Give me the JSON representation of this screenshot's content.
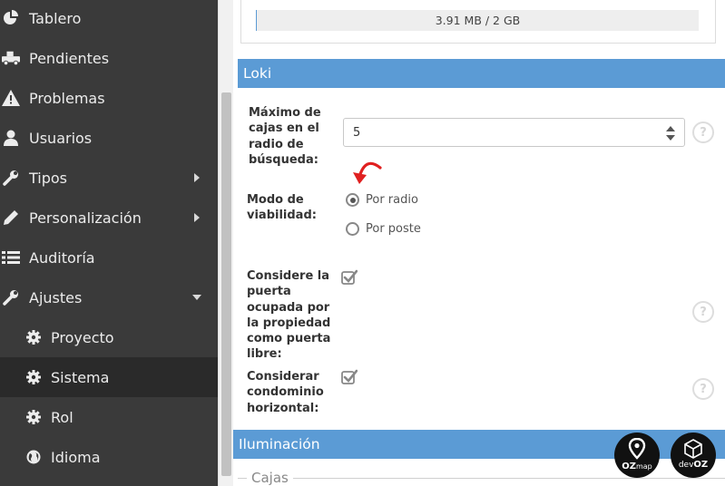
{
  "sidebar": {
    "items": [
      {
        "label": "Tablero",
        "icon": "pie-chart-icon"
      },
      {
        "label": "Pendientes",
        "icon": "truck-icon"
      },
      {
        "label": "Problemas",
        "icon": "warning-icon"
      },
      {
        "label": "Usuarios",
        "icon": "user-icon"
      },
      {
        "label": "Tipos",
        "icon": "wrench-icon"
      },
      {
        "label": "Personalización",
        "icon": "pencil-icon"
      },
      {
        "label": "Auditoría",
        "icon": "list-icon"
      },
      {
        "label": "Ajustes",
        "icon": "wrench-icon"
      },
      {
        "label": "Proyecto",
        "icon": "gear-icon"
      },
      {
        "label": "Sistema",
        "icon": "gear-icon"
      },
      {
        "label": "Rol",
        "icon": "gear-icon"
      },
      {
        "label": "Idioma",
        "icon": "globe-icon"
      }
    ],
    "active_item": "Sistema"
  },
  "storage": {
    "usage_text": "3.91 MB / 2 GB"
  },
  "loki": {
    "title": "Loki",
    "max_boxes": {
      "label": "Máximo de cajas en el radio de búsqueda:",
      "value": "5"
    },
    "viability_mode": {
      "label": "Modo de viabilidad:",
      "options": [
        "Por radio",
        "Por poste"
      ],
      "selected": "Por radio"
    },
    "occupied_door": {
      "label": "Considere la puerta ocupada por la propiedad como puerta libre:",
      "checked": true
    },
    "horizontal_condo": {
      "label": "Considerar condominio horizontal:",
      "checked": true
    },
    "help_symbol": "?"
  },
  "lighting": {
    "title": "Iluminación"
  },
  "boxes_legend": {
    "title": "Cajas"
  },
  "badges": {
    "ozmap": {
      "text_oz": "OZ",
      "text_map": "map"
    },
    "devoz": {
      "text_dev": "dev",
      "text_oz": "OZ"
    }
  },
  "colors": {
    "sidebar_bg": "#3a3a3a",
    "sidebar_active": "#2a2a2a",
    "accent_blue": "#5b9bd5",
    "annotation_red": "#e02020"
  }
}
